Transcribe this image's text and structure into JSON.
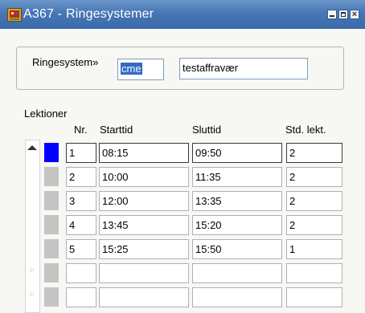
{
  "window": {
    "title": "A367 - Ringesystemer",
    "titlebar_color": "#4876b5",
    "icon": "oracle-forms-app-icon"
  },
  "ringesystem": {
    "label": "Ringesystem»",
    "code": "cme",
    "name": "testaffravær"
  },
  "lektioner": {
    "section_label": "Lektioner",
    "columns": {
      "nr": "Nr.",
      "start": "Starttid",
      "slut": "Sluttid",
      "std": "Std. lekt."
    },
    "rows": [
      {
        "nr": "1",
        "start": "08:15",
        "slut": "09:50",
        "std": "2",
        "current": true
      },
      {
        "nr": "2",
        "start": "10:00",
        "slut": "11:35",
        "std": "2",
        "current": false
      },
      {
        "nr": "3",
        "start": "12:00",
        "slut": "13:35",
        "std": "2",
        "current": false
      },
      {
        "nr": "4",
        "start": "13:45",
        "slut": "15:20",
        "std": "2",
        "current": false
      },
      {
        "nr": "5",
        "start": "15:25",
        "slut": "15:50",
        "std": "1",
        "current": false
      },
      {
        "nr": "",
        "start": "",
        "slut": "",
        "std": "",
        "current": false
      },
      {
        "nr": "",
        "start": "",
        "slut": "",
        "std": "",
        "current": false
      }
    ]
  }
}
